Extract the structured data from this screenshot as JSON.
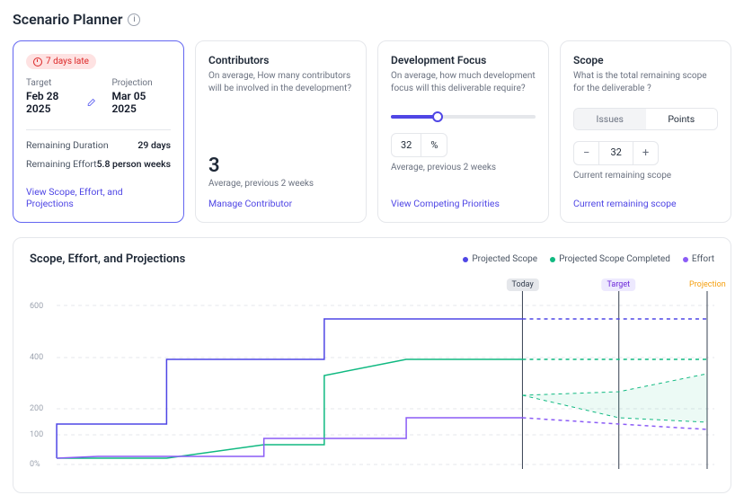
{
  "page_title": "Scenario Planner",
  "status_badge": "7 days late",
  "target_block": {
    "target_label": "Target",
    "target_value": "Feb 28 2025",
    "projection_label": "Projection",
    "projection_value": "Mar 05 2025",
    "remaining_duration_label": "Remaining Duration",
    "remaining_duration_value": "29 days",
    "remaining_effort_label": "Remaining Effort",
    "remaining_effort_value": "5.8 person weeks",
    "link": "View Scope, Effort, and Projections"
  },
  "contributors": {
    "title": "Contributors",
    "desc": "On average, How many contributors will be involved in the development?",
    "value": "3",
    "sub": "Average, previous 2 weeks",
    "link": "Manage Contributor"
  },
  "dev_focus": {
    "title": "Development Focus",
    "desc": "On average, how much development focus will this deliverable require?",
    "value": "32",
    "unit": "%",
    "sub": "Average, previous 2 weeks",
    "link": "View Competing Priorities"
  },
  "scope": {
    "title": "Scope",
    "desc": "What is the total remaining scope for the deliverable ?",
    "toggle_issues": "Issues",
    "toggle_points": "Points",
    "value": "32",
    "sub": "Current remaining scope",
    "link": "Current remaining scope"
  },
  "chart": {
    "title": "Scope, Effort, and Projections",
    "legend": {
      "projected_scope": "Projected Scope",
      "projected_completed": "Projected Scope Completed",
      "effort": "Effort"
    },
    "markers": {
      "today": "Today",
      "target": "Target",
      "projection": "Projection"
    },
    "y_ticks": [
      "600",
      "400",
      "200",
      "100",
      "0%"
    ]
  },
  "colors": {
    "scope": "#4f46e5",
    "completed": "#10b981",
    "effort": "#8b5cf6"
  },
  "chart_data": {
    "type": "line",
    "ylabel": "",
    "xlabel": "",
    "ylim": [
      0,
      700
    ],
    "markers": {
      "today": 0.72,
      "target": 0.86,
      "projection": 0.99
    },
    "x": [
      0.04,
      0.1,
      0.2,
      0.34,
      0.43,
      0.55,
      0.67,
      0.72,
      0.86,
      0.99
    ],
    "series": [
      {
        "name": "Projected Scope",
        "color": "#4f46e5",
        "values": [
          30,
          160,
          160,
          410,
          410,
          570,
          570,
          570,
          570,
          570
        ],
        "dashed_after": 0.72
      },
      {
        "name": "Projected Scope Completed",
        "color": "#10b981",
        "values": [
          30,
          30,
          30,
          80,
          80,
          340,
          410,
          410,
          410,
          410
        ],
        "dashed_after": 0.72,
        "projection_at_end": [
          180,
          380
        ]
      },
      {
        "name": "Effort",
        "color": "#8b5cf6",
        "values": [
          30,
          40,
          40,
          40,
          100,
          100,
          180,
          180,
          160,
          140
        ],
        "dashed_after": 0.72
      }
    ]
  }
}
